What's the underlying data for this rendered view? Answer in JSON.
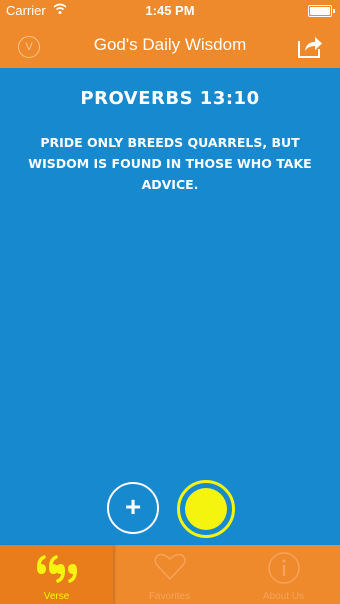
{
  "status_bar": {
    "carrier": "Carrier",
    "time": "1:45 PM"
  },
  "navbar": {
    "left_icon_label": "V",
    "title": "God's Daily Wisdom",
    "share_icon": "share-icon"
  },
  "verse": {
    "reference": "PROVERBS 13:10",
    "text": "PRIDE ONLY BREEDS QUARRELS, BUT WISDOM IS FOUND IN THOSE WHO TAKE ADVICE."
  },
  "actions": {
    "add_label": "+"
  },
  "tabs": [
    {
      "label": "Verse",
      "icon": "quote-icon",
      "active": true
    },
    {
      "label": "Favorites",
      "icon": "heart-icon",
      "active": false
    },
    {
      "label": "About Us",
      "icon": "info-icon",
      "active": false
    }
  ],
  "colors": {
    "header": "#ee8a2c",
    "background": "#1789cf",
    "accent": "#f4f40f"
  }
}
